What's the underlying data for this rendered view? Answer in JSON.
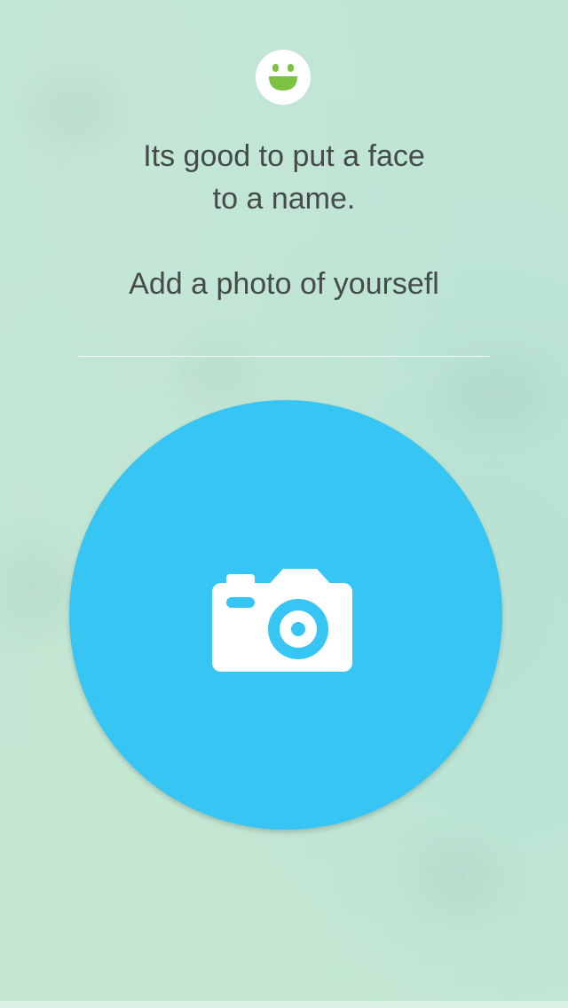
{
  "onboarding": {
    "logo_icon": "smiley-face-icon",
    "headline_line1": "Its good to put a face",
    "headline_line2": "to a name.",
    "prompt": "Add a photo of yoursefl",
    "photo_button_icon": "camera-icon"
  },
  "colors": {
    "background": "#bfe5d5",
    "accent_blue": "#37c5f3",
    "logo_green": "#7dc242",
    "text": "#454b4a"
  }
}
